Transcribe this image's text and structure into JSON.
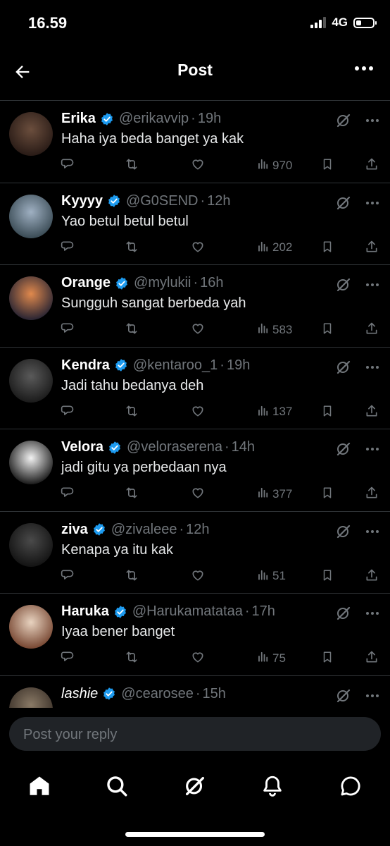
{
  "status_bar": {
    "time": "16.59",
    "network": "4G",
    "battery_level": 0.3
  },
  "header": {
    "title": "Post"
  },
  "replies": [
    {
      "name": "Erika",
      "handle": "@erikavvip",
      "time": "19h",
      "text": "Haha iya beda banget ya kak",
      "views": "970",
      "avatar_colors": [
        "#6b4e3d",
        "#2a1c17"
      ]
    },
    {
      "name": "Kyyyy",
      "handle": "@G0SEND",
      "time": "12h",
      "text": "Yao betul betul betul",
      "views": "202",
      "avatar_colors": [
        "#9fb0c2",
        "#3c4d57"
      ]
    },
    {
      "name": "Orange",
      "handle": "@mylukii",
      "time": "16h",
      "text": "Sungguh sangat berbeda yah",
      "views": "583",
      "avatar_colors": [
        "#e0894d",
        "#2c2633"
      ]
    },
    {
      "name": "Kendra",
      "handle": "@kentaroo_1",
      "time": "19h",
      "text": "Jadi tahu bedanya deh",
      "views": "137",
      "avatar_colors": [
        "#5a5a5a",
        "#1c1c1c"
      ]
    },
    {
      "name": "Velora",
      "handle": "@veloraserena",
      "time": "14h",
      "text": "jadi gitu ya perbedaan nya",
      "views": "377",
      "avatar_colors": [
        "#f2f2f2",
        "#1f1f1f"
      ]
    },
    {
      "name": "ziva",
      "handle": "@zivaleee",
      "time": "12h",
      "text": "Kenapa ya itu kak",
      "views": "51",
      "avatar_colors": [
        "#4a4a4a",
        "#141414"
      ]
    },
    {
      "name": "Haruka",
      "handle": "@Harukamatataa",
      "time": "17h",
      "text": "Iyaa bener banget",
      "views": "75",
      "avatar_colors": [
        "#e8d3c0",
        "#7a4a35"
      ]
    },
    {
      "name": "lashie",
      "handle": "@cearosee",
      "time": "15h",
      "text": "",
      "views": "",
      "avatar_colors": [
        "#8a7a66",
        "#3a3028"
      ]
    }
  ],
  "compose": {
    "placeholder": "Post your reply"
  },
  "colors": {
    "verified": "#1d9bf0",
    "muted": "#71767b",
    "divider": "#2f3336"
  },
  "nav": [
    "home-icon",
    "search-icon",
    "grok-icon",
    "notifications-icon",
    "messages-icon"
  ]
}
